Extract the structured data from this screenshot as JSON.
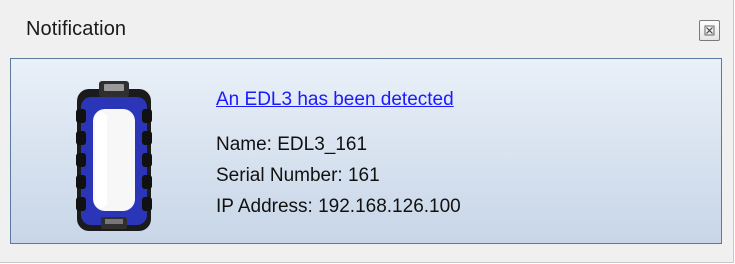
{
  "window": {
    "title": "Notification",
    "close_icon": "close-icon"
  },
  "notification": {
    "device_icon": "edl3-device-icon",
    "headline": "An EDL3 has been detected",
    "name_line": "Name: EDL3_161",
    "serial_line": "Serial Number: 161",
    "ip_line": "IP Address: 192.168.126.100"
  },
  "colors": {
    "link": "#1a1aff",
    "panel_top": "#e9f0f8",
    "panel_bottom": "#c8d6e8",
    "panel_border": "#5a7aa4",
    "device_accent": "#2a35b8"
  }
}
